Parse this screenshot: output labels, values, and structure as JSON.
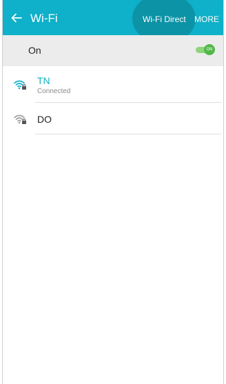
{
  "app_bar": {
    "title": "Wi-Fi",
    "wifi_direct_label": "Wi-Fi Direct",
    "more_label": "MORE",
    "color": "#0fb0c9"
  },
  "toggle_row": {
    "label": "On",
    "switch_text": "ON",
    "switch_color": "#52b848"
  },
  "networks": [
    {
      "name": "TN",
      "status": "Connected",
      "icon": "wifi-secured-icon",
      "name_color": "#0fb0c9"
    },
    {
      "name": "DO",
      "icon": "wifi-secured-icon",
      "name_color": "#222222"
    }
  ]
}
